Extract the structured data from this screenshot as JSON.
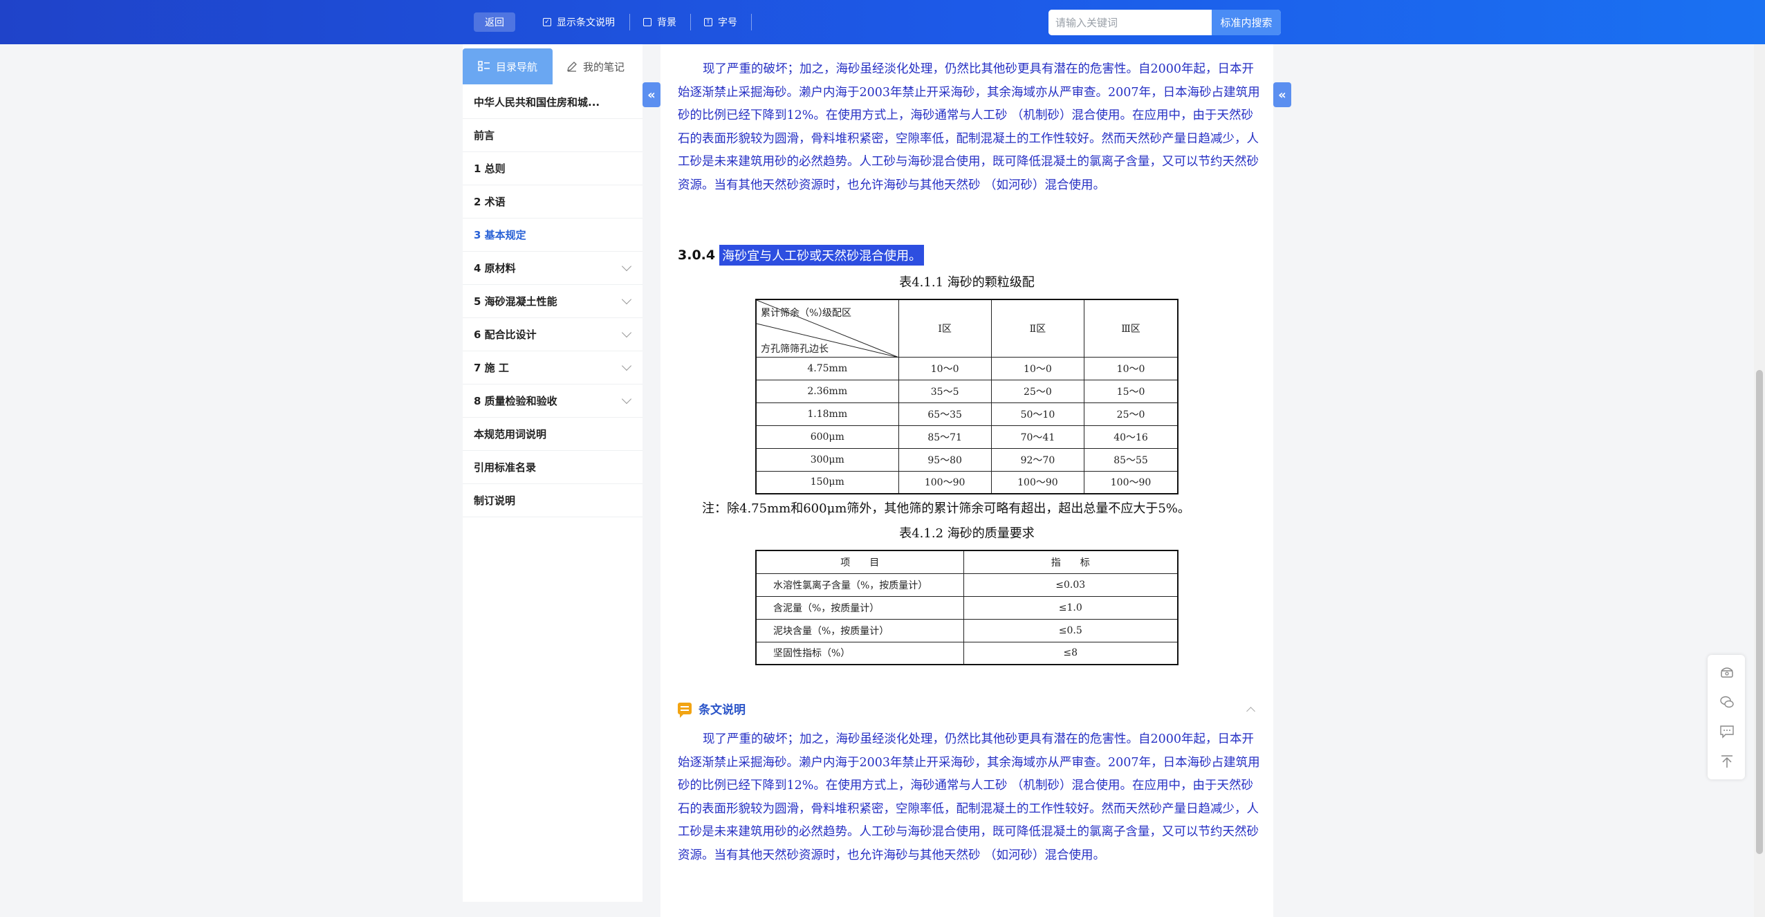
{
  "topbar": {
    "back_label": "返回",
    "show_explain_label": "显示条文说明",
    "background_label": "背景",
    "fontsize_label": "字号",
    "search_placeholder": "请输入关键词",
    "search_button_label": "标准内搜索"
  },
  "sidebar": {
    "tab_catalog": "目录导航",
    "tab_notes": "我的笔记",
    "items": [
      {
        "label": "中华人民共和国住房和城...",
        "expandable": false,
        "active": false
      },
      {
        "label": "前言",
        "expandable": false,
        "active": false
      },
      {
        "label": "1 总则",
        "expandable": false,
        "active": false
      },
      {
        "label": "2 术语",
        "expandable": false,
        "active": false
      },
      {
        "label": "3 基本规定",
        "expandable": false,
        "active": true
      },
      {
        "label": "4 原材料",
        "expandable": true,
        "active": false
      },
      {
        "label": "5 海砂混凝土性能",
        "expandable": true,
        "active": false
      },
      {
        "label": "6 配合比设计",
        "expandable": true,
        "active": false
      },
      {
        "label": "7 施 工",
        "expandable": true,
        "active": false
      },
      {
        "label": "8 质量检验和验收",
        "expandable": true,
        "active": false
      },
      {
        "label": "本规范用词说明",
        "expandable": false,
        "active": false
      },
      {
        "label": "引用标准名录",
        "expandable": false,
        "active": false
      },
      {
        "label": "制订说明",
        "expandable": false,
        "active": false
      }
    ]
  },
  "content": {
    "para_top": "现了严重的破坏；加之，海砂虽经淡化处理，仍然比其他砂更具有潜在的危害性。自2000年起，日本开始逐渐禁止采掘海砂。濑户内海于2003年禁止开采海砂，其余海域亦从严审查。2007年，日本海砂占建筑用砂的比例已经下降到12%。在使用方式上，海砂通常与人工砂 （机制砂）混合使用。在应用中，由于天然砂石的表面形貌较为圆滑，骨料堆积紧密，空隙率低，配制混凝土的工作性较好。然而天然砂产量日趋减少，人工砂是未来建筑用砂的必然趋势。人工砂与海砂混合使用，既可降低混凝土的氯离子含量，又可以节约天然砂资源。当有其他天然砂资源时，也允许海砂与其他天然砂 （如河砂）混合使用。",
    "clause_number": "3.0.4",
    "clause_text": "海砂宜与人工砂或天然砂混合使用。",
    "table1_caption": "表4.1.1 海砂的颗粒级配",
    "table1": {
      "diag_top_left": "累计筛余（%）",
      "diag_top_right": "级配区",
      "diag_bottom": "方孔筛筛孔边长",
      "columns": [
        "Ⅰ区",
        "Ⅱ区",
        "Ⅲ区"
      ],
      "rows": [
        [
          "4.75mm",
          "10～0",
          "10～0",
          "10～0"
        ],
        [
          "2.36mm",
          "35～5",
          "25～0",
          "15～0"
        ],
        [
          "1.18mm",
          "65～35",
          "50～10",
          "25～0"
        ],
        [
          "600μm",
          "85～71",
          "70～41",
          "40～16"
        ],
        [
          "300μm",
          "95～80",
          "92～70",
          "85～55"
        ],
        [
          "150μm",
          "100～90",
          "100～90",
          "100～90"
        ]
      ]
    },
    "note": "注：除4.75mm和600μm筛外，其他筛的累计筛余可略有超出，超出总量不应大于5%。",
    "table2_caption": "表4.1.2 海砂的质量要求",
    "table2": {
      "head_item": "项　　目",
      "head_index": "指　　标",
      "rows": [
        [
          "水溶性氯离子含量（%，按质量计）",
          "≤0.03"
        ],
        [
          "含泥量（%，按质量计）",
          "≤1.0"
        ],
        [
          "泥块含量（%，按质量计）",
          "≤0.5"
        ],
        [
          "坚固性指标（%）",
          "≤8"
        ]
      ]
    },
    "section_title": "条文说明",
    "para_bottom": "现了严重的破坏；加之，海砂虽经淡化处理，仍然比其他砂更具有潜在的危害性。自2000年起，日本开始逐渐禁止采掘海砂。濑户内海于2003年禁止开采海砂，其余海域亦从严审查。2007年，日本海砂占建筑用砂的比例已经下降到12%。在使用方式上，海砂通常与人工砂 （机制砂）混合使用。在应用中，由于天然砂石的表面形貌较为圆滑，骨料堆积紧密，空隙率低，配制混凝土的工作性较好。然而天然砂产量日趋减少，人工砂是未来建筑用砂的必然趋势。人工砂与海砂混合使用，既可降低混凝土的氯离子含量，又可以节约天然砂资源。当有其他天然砂资源时，也允许海砂与其他天然砂 （如河砂）混合使用。"
  },
  "colors": {
    "topbar_start": "#1f43c9",
    "topbar_end": "#1a71f2",
    "accent": "#2a62d6",
    "body_text": "#2630c4",
    "highlight": "#2d4ee0"
  }
}
